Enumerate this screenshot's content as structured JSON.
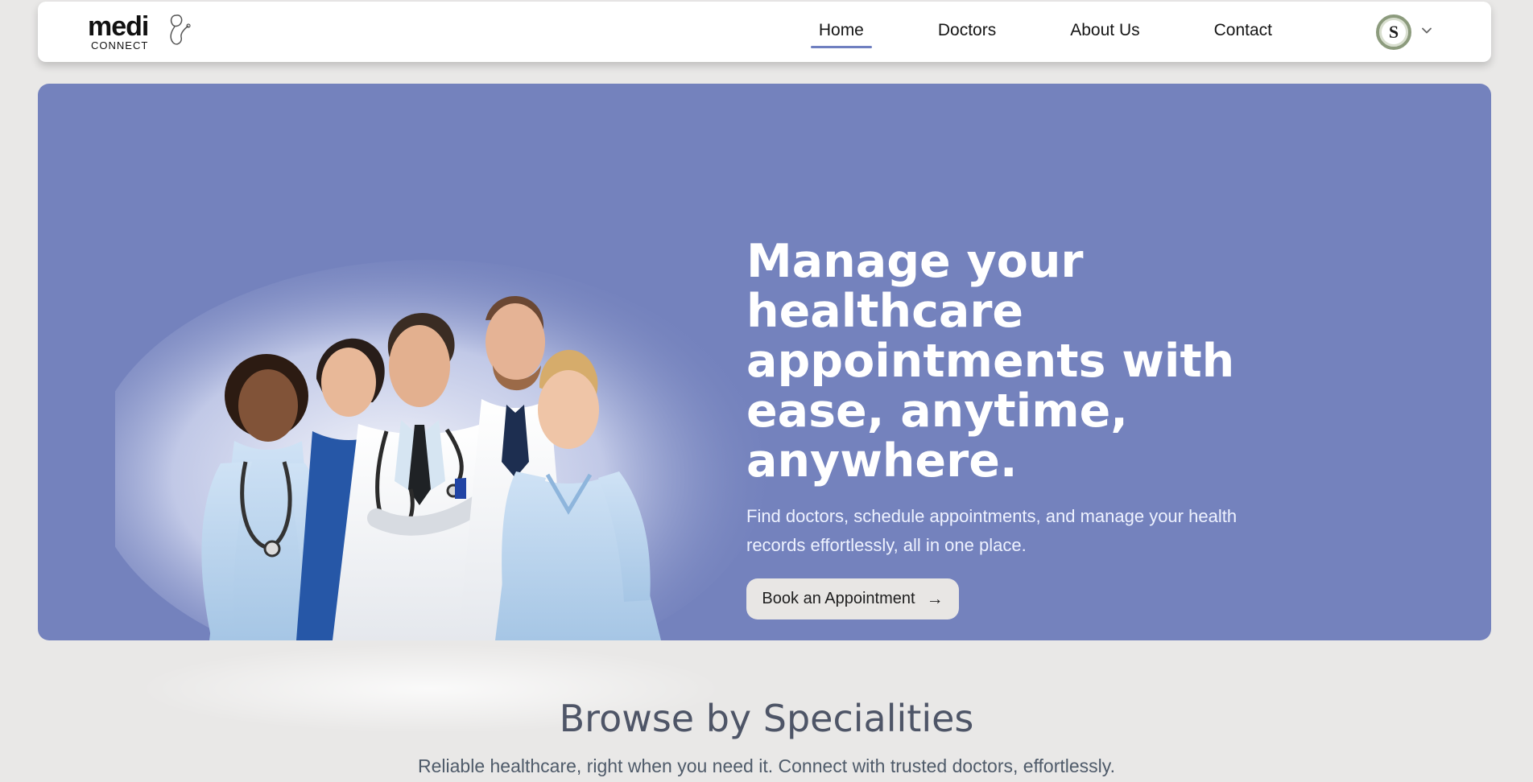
{
  "brand": {
    "logo_text": "medi",
    "logo_subtext": "CONNECT",
    "icon": "stethoscope-logo-icon"
  },
  "navigation": {
    "items": [
      {
        "label": "Home",
        "active": true
      },
      {
        "label": "Doctors",
        "active": false
      },
      {
        "label": "About Us",
        "active": false
      },
      {
        "label": "Contact",
        "active": false
      }
    ],
    "profile": {
      "initial": "S",
      "icon": "avatar-icon",
      "dropdown_icon": "chevron-down-icon"
    }
  },
  "hero": {
    "title": "Manage your healthcare appointments with ease, anytime, anywhere.",
    "subtitle": "Find doctors, schedule appointments, and manage your health records effortlessly, all in one place.",
    "button_label": "Book an Appointment",
    "button_icon": "→",
    "image_icon": "medical-team-illustration"
  },
  "specialities": {
    "heading": "Browse by Specialities",
    "subtitle": "Reliable healthcare, right when you need it. Connect with trusted doctors, effortlessly."
  },
  "colors": {
    "hero_background": "#7482bd",
    "page_background": "#e9e8e7",
    "nav_active": "#6f7fc0",
    "button_background": "#e8e6e4",
    "heading_text": "#4e5567"
  }
}
